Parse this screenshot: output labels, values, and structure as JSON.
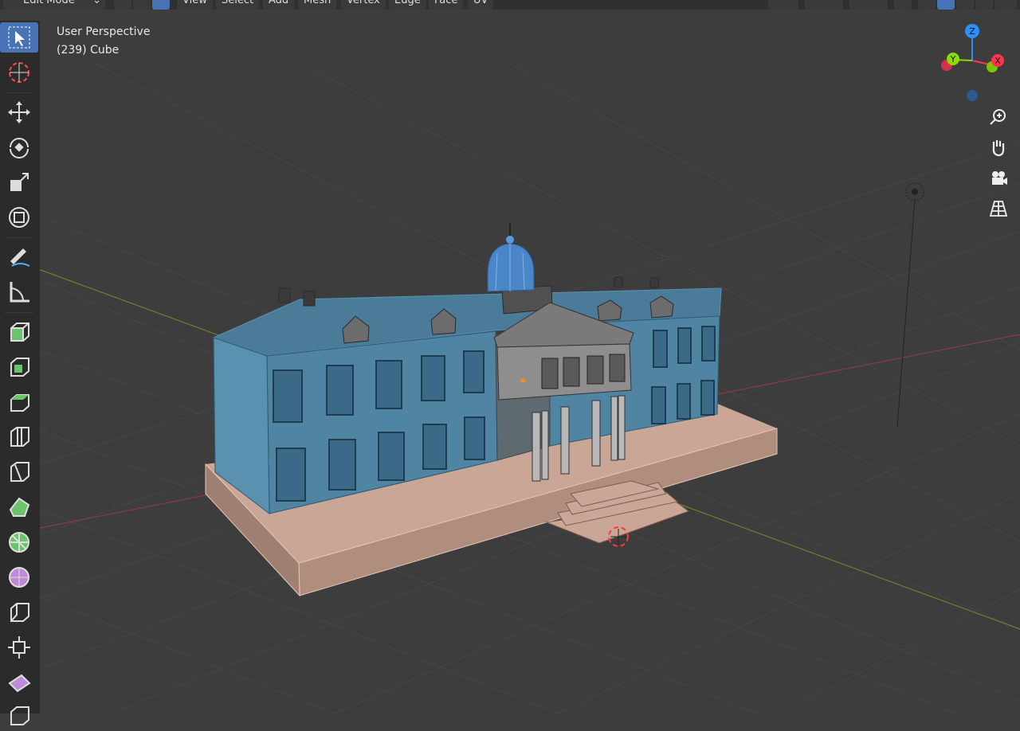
{
  "header": {
    "mode_label": "Edit Mode",
    "menus": [
      "View",
      "Select",
      "Add",
      "Mesh",
      "Vertex",
      "Edge",
      "Face",
      "UV"
    ]
  },
  "viewport": {
    "view_name": "User Perspective",
    "object_info": "(239) Cube"
  },
  "gizmo": {
    "x_label": "X",
    "y_label": "Y",
    "z_label": "Z"
  },
  "toolbar": {
    "tools": [
      "select-box-icon",
      "cursor-icon",
      "move-icon",
      "rotate-icon",
      "scale-icon",
      "transform-icon",
      "annotate-icon",
      "measure-icon",
      "add-cube-icon",
      "extrude-region-icon",
      "inset-faces-icon",
      "bevel-icon",
      "loop-cut-icon",
      "knife-icon",
      "poly-build-icon",
      "spin-icon",
      "smooth-icon",
      "edge-slide-icon",
      "shrink-fatten-icon",
      "shear-icon",
      "rip-region-icon"
    ]
  },
  "colors": {
    "viewport_bg": "#3d3d3d",
    "active_tool": "#4772b3",
    "axis_x": "#ff3352",
    "axis_y": "#8bdc00",
    "axis_z": "#2890ff",
    "building_wall": "#4f85a4",
    "base_plinth": "#c6a290",
    "portico": "#8c8c8c",
    "dome": "#4a86c8"
  }
}
